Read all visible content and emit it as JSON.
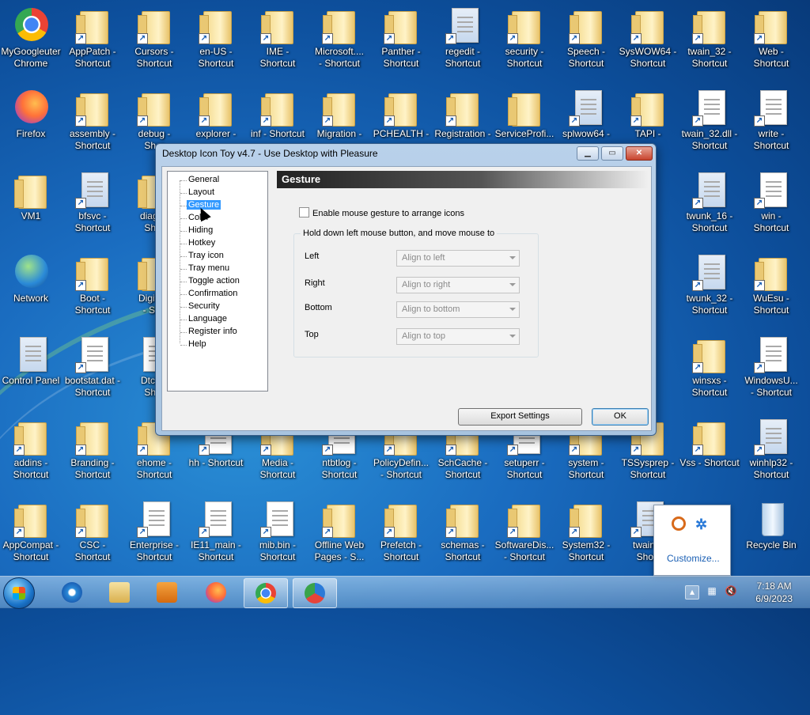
{
  "desktop": {
    "icons": [
      {
        "label": "MyGoogleuter\nChrome",
        "kind": "chrome"
      },
      {
        "label": "AppPatch -\nShortcut",
        "kind": "folder"
      },
      {
        "label": "Cursors -\nShortcut",
        "kind": "folder"
      },
      {
        "label": "en-US -\nShortcut",
        "kind": "folder"
      },
      {
        "label": "IME -\nShortcut",
        "kind": "folder"
      },
      {
        "label": "Microsoft....\n- Shortcut",
        "kind": "folder"
      },
      {
        "label": "Panther -\nShortcut",
        "kind": "folder"
      },
      {
        "label": "regedit -\nShortcut",
        "kind": "app"
      },
      {
        "label": "security -\nShortcut",
        "kind": "folder"
      },
      {
        "label": "Speech -\nShortcut",
        "kind": "folder"
      },
      {
        "label": "SysWOW64 -\nShortcut",
        "kind": "folder"
      },
      {
        "label": "twain_32 -\nShortcut",
        "kind": "folder"
      },
      {
        "label": "Web -\nShortcut",
        "kind": "folder"
      },
      {
        "label": "Firefox",
        "kind": "firefox"
      },
      {
        "label": "assembly -\nShortcut",
        "kind": "folder"
      },
      {
        "label": "debug -\nShor",
        "kind": "folder"
      },
      {
        "label": "explorer -",
        "kind": "folder"
      },
      {
        "label": "inf - Shortcut",
        "kind": "folder"
      },
      {
        "label": "Migration -",
        "kind": "folder"
      },
      {
        "label": "PCHEALTH -",
        "kind": "folder"
      },
      {
        "label": "Registration -",
        "kind": "folder"
      },
      {
        "label": "ServiceProfi...",
        "kind": "folder"
      },
      {
        "label": "splwow64 -",
        "kind": "app"
      },
      {
        "label": "TAPI -",
        "kind": "folder"
      },
      {
        "label": "twain_32.dll -\nShortcut",
        "kind": "doc"
      },
      {
        "label": "write -\nShortcut",
        "kind": "doc"
      },
      {
        "label": "VM1",
        "kind": "folder"
      },
      {
        "label": "bfsvc -\nShortcut",
        "kind": "app"
      },
      {
        "label": "diagno\nShor",
        "kind": "folder"
      },
      {
        "label": "twunk_16 -\nShortcut",
        "kind": "app"
      },
      {
        "label": "win -\nShortcut",
        "kind": "doc"
      },
      {
        "label": "Network",
        "kind": "network"
      },
      {
        "label": "Boot -\nShortcut",
        "kind": "folder"
      },
      {
        "label": "DigitalL\n- Sho",
        "kind": "folder"
      },
      {
        "label": "twunk_32 -\nShortcut",
        "kind": "app"
      },
      {
        "label": "WuEsu -\nShortcut",
        "kind": "folder"
      },
      {
        "label": "Control Panel",
        "kind": "app"
      },
      {
        "label": "bootstat.dat -\nShortcut",
        "kind": "doc"
      },
      {
        "label": "DtcIns\nShor",
        "kind": "doc"
      },
      {
        "label": "winsxs -\nShortcut",
        "kind": "folder"
      },
      {
        "label": "WindowsU...\n- Shortcut",
        "kind": "doc"
      },
      {
        "label": "addins -\nShortcut",
        "kind": "folder"
      },
      {
        "label": "Branding -\nShortcut",
        "kind": "folder"
      },
      {
        "label": "ehome -\nShortcut",
        "kind": "folder"
      },
      {
        "label": "hh - Shortcut",
        "kind": "doc"
      },
      {
        "label": "Media -\nShortcut",
        "kind": "folder"
      },
      {
        "label": "ntbtlog -\nShortcut",
        "kind": "doc"
      },
      {
        "label": "PolicyDefin...\n- Shortcut",
        "kind": "folder"
      },
      {
        "label": "SchCache -\nShortcut",
        "kind": "folder"
      },
      {
        "label": "setuperr -\nShortcut",
        "kind": "doc"
      },
      {
        "label": "system -\nShortcut",
        "kind": "folder"
      },
      {
        "label": "TSSysprep -\nShortcut",
        "kind": "folder"
      },
      {
        "label": "Vss - Shortcut",
        "kind": "folder"
      },
      {
        "label": "winhlp32 -\nShortcut",
        "kind": "app"
      },
      {
        "label": "AppCompat -\nShortcut",
        "kind": "folder"
      },
      {
        "label": "CSC -\nShortcut",
        "kind": "folder"
      },
      {
        "label": "Enterprise -\nShortcut",
        "kind": "doc"
      },
      {
        "label": "IE11_main -\nShortcut",
        "kind": "doc"
      },
      {
        "label": "mib.bin -\nShortcut",
        "kind": "doc"
      },
      {
        "label": "Offline Web\nPages - S...",
        "kind": "folder"
      },
      {
        "label": "Prefetch -\nShortcut",
        "kind": "folder"
      },
      {
        "label": "schemas -\nShortcut",
        "kind": "folder"
      },
      {
        "label": "SoftwareDis...\n- Shortcut",
        "kind": "folder"
      },
      {
        "label": "System32 -\nShortcut",
        "kind": "folder"
      },
      {
        "label": "twain...\nShort",
        "kind": "app"
      },
      {
        "label": "Recycle Bin",
        "kind": "recycle"
      }
    ]
  },
  "dialog": {
    "title": "Desktop Icon Toy v4.7 - Use Desktop with Pleasure",
    "tree": [
      "General",
      "Layout",
      "Gesture",
      "Color",
      "Hiding",
      "Hotkey",
      "Tray icon",
      "Tray menu",
      "Toggle action",
      "Confirmation",
      "Security",
      "Language",
      "Register info",
      "Help"
    ],
    "selected": "Gesture",
    "panel_title": "Gesture",
    "enable_label": "Enable mouse gesture to arrange icons",
    "group_label": "Hold down left mouse button, and move mouse to",
    "rows": [
      {
        "label": "Left",
        "value": "Align to left"
      },
      {
        "label": "Right",
        "value": "Align to right"
      },
      {
        "label": "Bottom",
        "value": "Align to bottom"
      },
      {
        "label": "Top",
        "value": "Align to top"
      }
    ],
    "export_label": "Export Settings",
    "ok_label": "OK"
  },
  "popup": {
    "customize": "Customize..."
  },
  "taskbar": {
    "time": "7:18 AM",
    "date": "6/9/2023"
  }
}
